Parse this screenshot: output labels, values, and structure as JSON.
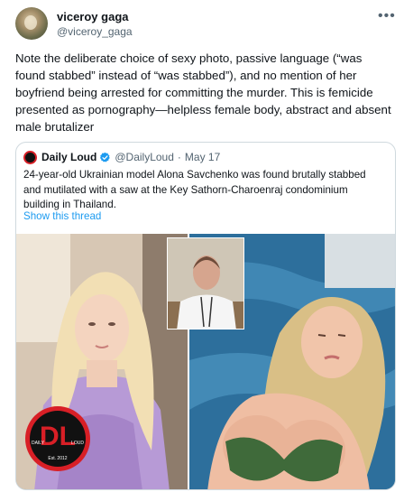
{
  "author": {
    "name": "viceroy gaga",
    "handle": "@viceroy_gaga"
  },
  "tweet": {
    "text": "Note the deliberate choice of sexy photo, passive language (“was found stabbed” instead of “was stabbed”), and no mention of her boyfriend being arrested for committing the murder. This is femicide presented as pornography—helpless female body, abstract and absent male brutalizer"
  },
  "more_icon": "more-horizontal-icon",
  "quoted": {
    "name": "Daily Loud",
    "verified_icon": "verified-badge-icon",
    "handle": "@DailyLoud",
    "separator": "·",
    "date": "May 17",
    "text": "24-year-old Ukrainian model Alona Savchenko was found brutally stabbed and mutilated with a saw at the Key Sathorn-Charoenraj condominium building in Thailand.",
    "show_thread": "Show this thread",
    "logo": {
      "letters": "DL",
      "left": "DAILY",
      "right": "LOUD",
      "est": "Est. 2012"
    }
  },
  "colors": {
    "link": "#1d9bf0",
    "secondary_text": "#536471",
    "border": "#cfd9de",
    "logo_red": "#d81f26"
  }
}
